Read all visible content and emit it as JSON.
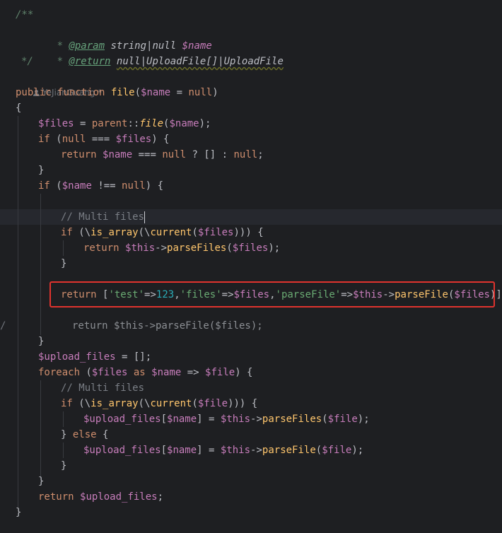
{
  "editor": {
    "language": "PHP",
    "colors": {
      "background": "#1e1f22",
      "highlight_box": "#e0332e",
      "keyword": "#cf8e6d",
      "variable": "#c77dbb",
      "string": "#6aab73",
      "number": "#2aacb8",
      "comment": "#7a7e85",
      "method": "#ffc66d"
    },
    "author_hint": "YeJianGuang *",
    "doc": {
      "open": "/**",
      "param_tag": "@param",
      "param_type": "string|null",
      "param_var": "$name",
      "return_tag": "@return",
      "return_type": "null|UploadFile[]|UploadFile",
      "close": "*/"
    },
    "lines": [
      {
        "t": [
          [
            "kw",
            "public "
          ],
          [
            "kw",
            "function "
          ],
          [
            "fnmine",
            "file"
          ],
          [
            "p",
            "("
          ],
          [
            "var",
            "$name"
          ],
          [
            "p",
            " = "
          ],
          [
            "kw",
            "null"
          ],
          [
            "p",
            ")"
          ]
        ]
      },
      {
        "t": [
          [
            "p",
            "{"
          ]
        ]
      },
      {
        "t": [
          [
            "var",
            "$files"
          ],
          [
            "p",
            " = "
          ],
          [
            "kw",
            "parent"
          ],
          [
            "p",
            "::"
          ],
          [
            "fnit",
            "file"
          ],
          [
            "p",
            "("
          ],
          [
            "var",
            "$name"
          ],
          [
            "p",
            ");"
          ]
        ]
      },
      {
        "t": [
          [
            "kw",
            "if "
          ],
          [
            "p",
            "("
          ],
          [
            "kw",
            "null"
          ],
          [
            "p",
            " === "
          ],
          [
            "var",
            "$files"
          ],
          [
            "p",
            ") {"
          ]
        ]
      },
      {
        "t": [
          [
            "kw",
            "return "
          ],
          [
            "var",
            "$name"
          ],
          [
            "p",
            " === "
          ],
          [
            "kw",
            "null"
          ],
          [
            "p",
            " ? [] : "
          ],
          [
            "kw",
            "null"
          ],
          [
            "p",
            ";"
          ]
        ]
      },
      {
        "t": [
          [
            "p",
            "}"
          ]
        ]
      },
      {
        "t": [
          [
            "kw",
            "if "
          ],
          [
            "p",
            "("
          ],
          [
            "var",
            "$name"
          ],
          [
            "p",
            " !== "
          ],
          [
            "kw",
            "null"
          ],
          [
            "p",
            ") {"
          ]
        ]
      },
      {
        "t": []
      },
      {
        "t": [
          [
            "cm",
            "// Multi files"
          ]
        ]
      },
      {
        "t": [
          [
            "kw",
            "if "
          ],
          [
            "p",
            "(\\"
          ],
          [
            "fnmine",
            "is_array"
          ],
          [
            "p",
            "(\\"
          ],
          [
            "fnmine",
            "current"
          ],
          [
            "p",
            "("
          ],
          [
            "var",
            "$files"
          ],
          [
            "p",
            "))) {"
          ]
        ]
      },
      {
        "t": [
          [
            "kw",
            "return "
          ],
          [
            "var",
            "$this"
          ],
          [
            "p",
            "->"
          ],
          [
            "fnmine",
            "parseFiles"
          ],
          [
            "p",
            "("
          ],
          [
            "var",
            "$files"
          ],
          [
            "p",
            ");"
          ]
        ]
      },
      {
        "t": [
          [
            "p",
            "}"
          ]
        ]
      },
      {
        "t": []
      },
      {
        "t": [
          [
            "kw",
            "return "
          ],
          [
            "p",
            "["
          ],
          [
            "str",
            "'test'"
          ],
          [
            "p",
            "=>"
          ],
          [
            "num",
            "123"
          ],
          [
            "p",
            ","
          ],
          [
            "str",
            "'files'"
          ],
          [
            "p",
            "=>"
          ],
          [
            "var",
            "$files"
          ],
          [
            "p",
            ","
          ],
          [
            "str",
            "'parseFile'"
          ],
          [
            "p",
            "=>"
          ],
          [
            "var",
            "$this"
          ],
          [
            "p",
            "->"
          ],
          [
            "fnmine",
            "parseFile"
          ],
          [
            "p",
            "("
          ],
          [
            "var",
            "$files"
          ],
          [
            "p",
            ")];"
          ]
        ]
      },
      {
        "t": []
      },
      {
        "t": [
          [
            "dim",
            "return $this->parseFile($files);"
          ]
        ]
      },
      {
        "t": [
          [
            "p",
            "}"
          ]
        ]
      },
      {
        "t": [
          [
            "var",
            "$upload_files"
          ],
          [
            "p",
            " = [];"
          ]
        ]
      },
      {
        "t": [
          [
            "kw",
            "foreach "
          ],
          [
            "p",
            "("
          ],
          [
            "var",
            "$files"
          ],
          [
            "kw",
            " as "
          ],
          [
            "var",
            "$name"
          ],
          [
            "p",
            " => "
          ],
          [
            "var",
            "$file"
          ],
          [
            "p",
            ") {"
          ]
        ]
      },
      {
        "t": [
          [
            "cm",
            "// Multi files"
          ]
        ]
      },
      {
        "t": [
          [
            "kw",
            "if "
          ],
          [
            "p",
            "(\\"
          ],
          [
            "fnmine",
            "is_array"
          ],
          [
            "p",
            "(\\"
          ],
          [
            "fnmine",
            "current"
          ],
          [
            "p",
            "("
          ],
          [
            "var",
            "$file"
          ],
          [
            "p",
            "))) {"
          ]
        ]
      },
      {
        "t": [
          [
            "var",
            "$upload_files"
          ],
          [
            "p",
            "["
          ],
          [
            "var",
            "$name"
          ],
          [
            "p",
            "] = "
          ],
          [
            "var",
            "$this"
          ],
          [
            "p",
            "->"
          ],
          [
            "fnmine",
            "parseFiles"
          ],
          [
            "p",
            "("
          ],
          [
            "var",
            "$file"
          ],
          [
            "p",
            ");"
          ]
        ]
      },
      {
        "t": [
          [
            "p",
            "} "
          ],
          [
            "kw",
            "else "
          ],
          [
            "p",
            "{"
          ]
        ]
      },
      {
        "t": [
          [
            "var",
            "$upload_files"
          ],
          [
            "p",
            "["
          ],
          [
            "var",
            "$name"
          ],
          [
            "p",
            "] = "
          ],
          [
            "var",
            "$this"
          ],
          [
            "p",
            "->"
          ],
          [
            "fnmine",
            "parseFile"
          ],
          [
            "p",
            "("
          ],
          [
            "var",
            "$file"
          ],
          [
            "p",
            ");"
          ]
        ]
      },
      {
        "t": [
          [
            "p",
            "}"
          ]
        ]
      },
      {
        "t": [
          [
            "p",
            "}"
          ]
        ]
      },
      {
        "t": [
          [
            "kw",
            "return "
          ],
          [
            "var",
            "$upload_files"
          ],
          [
            "p",
            ";"
          ]
        ]
      },
      {
        "t": [
          [
            "p",
            "}"
          ]
        ]
      }
    ]
  }
}
